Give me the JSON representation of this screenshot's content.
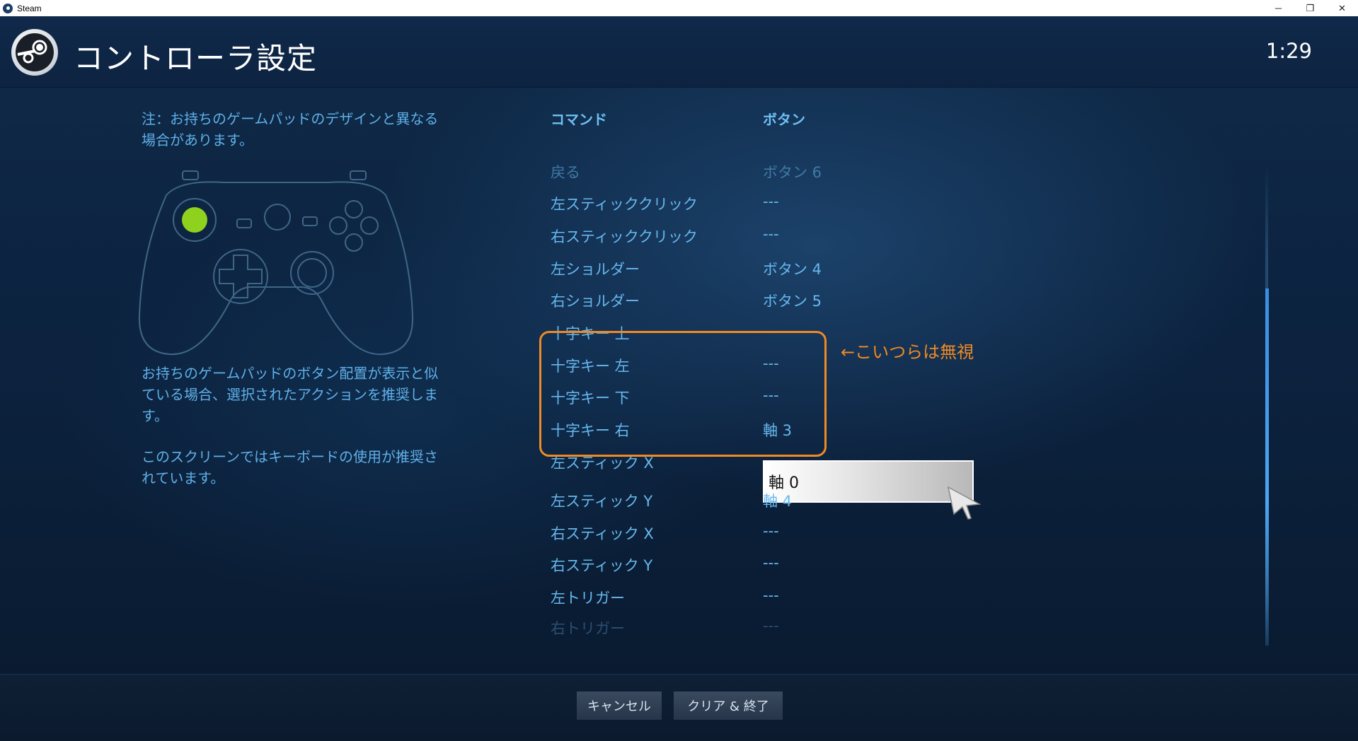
{
  "window": {
    "title": "Steam",
    "minimize": "─",
    "restore": "❐",
    "close": "✕"
  },
  "header": {
    "title": "コントローラ設定",
    "clock": "1:29"
  },
  "left": {
    "note": "注：お持ちのゲームパッドのデザインと異なる場合があります。",
    "desc1": "お持ちのゲームパッドのボタン配置が表示と似ている場合、選択されたアクションを推奨します。",
    "desc2": "このスクリーンではキーボードの使用が推奨されています。"
  },
  "table": {
    "col_command": "コマンド",
    "col_button": "ボタン",
    "rows": [
      {
        "command": "戻る",
        "value": "ボタン 6"
      },
      {
        "command": "左スティッククリック",
        "value": "---"
      },
      {
        "command": "右スティッククリック",
        "value": "---"
      },
      {
        "command": "左ショルダー",
        "value": "ボタン 4"
      },
      {
        "command": "右ショルダー",
        "value": "ボタン 5"
      },
      {
        "command": "十字キー 上",
        "value": "---"
      },
      {
        "command": "十字キー 左",
        "value": "---"
      },
      {
        "command": "十字キー 下",
        "value": "---"
      },
      {
        "command": "十字キー 右",
        "value": "軸 3"
      },
      {
        "command": "左スティック X",
        "value": "軸 0"
      },
      {
        "command": "左スティック Y",
        "value": "軸 4"
      },
      {
        "command": "右スティック X",
        "value": "---"
      },
      {
        "command": "右スティック Y",
        "value": "---"
      },
      {
        "command": "左トリガー",
        "value": "---"
      },
      {
        "command": "右トリガー",
        "value": "---"
      }
    ]
  },
  "annotation": "←こいつらは無視",
  "footer": {
    "cancel": "キャンセル",
    "clear_exit": "クリア & 終了"
  },
  "colors": {
    "accent": "#66b8ee",
    "annotation": "#f08a24",
    "gamepad_highlight": "#8ed21e"
  },
  "icons": {
    "steam": "steam-logo-icon",
    "gamepad": "gamepad-icon",
    "cursor": "mouse-cursor-icon"
  }
}
